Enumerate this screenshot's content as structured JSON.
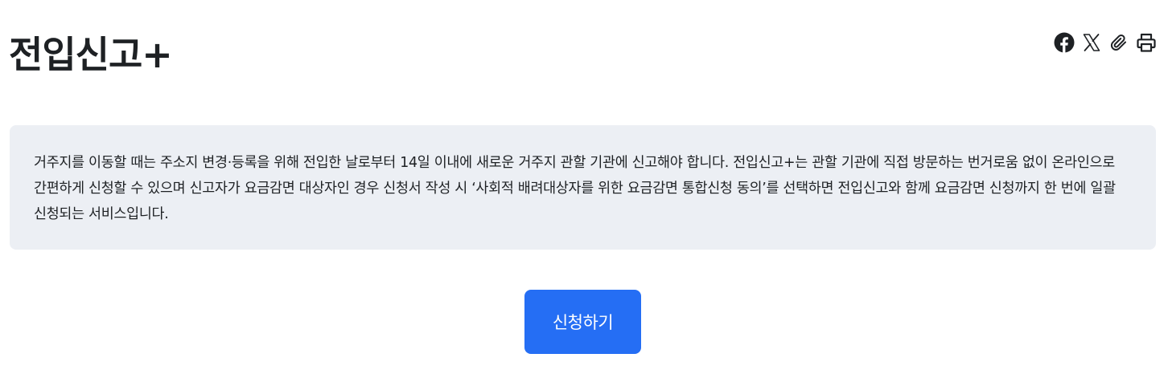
{
  "page": {
    "title": "전입신고+"
  },
  "share_bar": {
    "items": [
      {
        "icon": "facebook-icon"
      },
      {
        "icon": "x-icon"
      },
      {
        "icon": "paperclip-icon"
      },
      {
        "icon": "print-icon"
      }
    ],
    "icon_color": "#1e2124"
  },
  "notice": {
    "text": "거주지를 이동할 때는 주소지 변경·등록을 위해 전입한 날로부터 14일 이내에 새로운 거주지 관할 기관에 신고해야 합니다. 전입신고+는 관할 기관에 직접 방문하는 번거로움 없이 온라인으로 간편하게 신청할 수 있으며 신고자가 요금감면 대상자인 경우 신청서 작성 시 ‘사회적 배려대상자를 위한 요금감면 통합신청 동의’를 선택하면 전입신고와 함께 요금감면 신청까지 한 번에 일괄 신청되는 서비스입니다.",
    "background": "#eceff4"
  },
  "actions": {
    "apply_label": "신청하기",
    "apply_color": "#256ef4"
  }
}
